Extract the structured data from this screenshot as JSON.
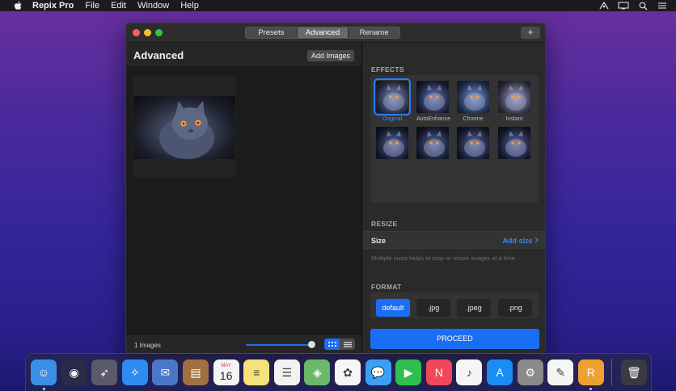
{
  "menubar": {
    "app_name": "Repix Pro",
    "items": [
      "File",
      "Edit",
      "Window",
      "Help"
    ],
    "status_icons": [
      "sync-icon",
      "display-icon",
      "search-icon",
      "list-icon"
    ]
  },
  "window": {
    "tabs": [
      {
        "label": "Presets",
        "active": false
      },
      {
        "label": "Advanced",
        "active": true
      },
      {
        "label": "Rename",
        "active": false
      }
    ],
    "plus_label": "+"
  },
  "left": {
    "title": "Advanced",
    "add_images_label": "Add Images",
    "image_count": "1 Images",
    "zoom_slider": 0.9
  },
  "right": {
    "effects_title": "EFFECTS",
    "effects": [
      {
        "label": "Original",
        "selected": true,
        "tone": ""
      },
      {
        "label": "AutoEnhance",
        "selected": false,
        "tone": "tone-enh"
      },
      {
        "label": "Chrome",
        "selected": false,
        "tone": "tone-chr"
      },
      {
        "label": "Instant",
        "selected": false,
        "tone": "tone-ins"
      },
      {
        "label": "",
        "selected": false,
        "tone": "tone-dk"
      },
      {
        "label": "",
        "selected": false,
        "tone": "tone-dk"
      },
      {
        "label": "",
        "selected": false,
        "tone": "tone-dk"
      },
      {
        "label": "",
        "selected": false,
        "tone": "tone-dk"
      }
    ],
    "resize_title": "RESIZE",
    "size_label": "Size",
    "add_size_label": "Add size",
    "size_hint": "Multiple sizes helps to crop or resize images at a time",
    "format_title": "FORMAT",
    "formats": [
      {
        "label": "default",
        "active": true
      },
      {
        "label": ".jpg",
        "active": false
      },
      {
        "label": ".jpeg",
        "active": false
      },
      {
        "label": ".png",
        "active": false
      }
    ],
    "proceed_label": "PROCEED"
  },
  "calendar": {
    "month": "MAY",
    "day": "16"
  },
  "dock": {
    "items": [
      {
        "name": "finder-icon",
        "bg": "#3a8fe6",
        "running": true
      },
      {
        "name": "siri-icon",
        "bg": "#2a2a4a",
        "running": false
      },
      {
        "name": "launchpad-icon",
        "bg": "#5a5a6a",
        "running": false
      },
      {
        "name": "safari-icon",
        "bg": "#2d8cf0",
        "running": false
      },
      {
        "name": "mail-icon",
        "bg": "#4a78c8",
        "running": false
      },
      {
        "name": "contacts-icon",
        "bg": "#a07040",
        "running": false
      },
      {
        "name": "calendar-icon",
        "bg": "#f4f4f4",
        "running": false
      },
      {
        "name": "notes-icon",
        "bg": "#f5e27a",
        "running": false
      },
      {
        "name": "reminders-icon",
        "bg": "#f2f2f2",
        "running": false
      },
      {
        "name": "maps-icon",
        "bg": "#6ab86a",
        "running": false
      },
      {
        "name": "photos-icon",
        "bg": "#f5f5f5",
        "running": false
      },
      {
        "name": "messages-icon",
        "bg": "#3aa0f5",
        "running": false
      },
      {
        "name": "facetime-icon",
        "bg": "#2fbf4f",
        "running": false
      },
      {
        "name": "news-icon",
        "bg": "#f0485a",
        "running": false
      },
      {
        "name": "music-icon",
        "bg": "#f5f5f5",
        "running": false
      },
      {
        "name": "app-store-icon",
        "bg": "#1a8cf5",
        "running": false
      },
      {
        "name": "system-preferences-icon",
        "bg": "#8a8a8a",
        "running": false
      },
      {
        "name": "textedit-icon",
        "bg": "#f5f5f5",
        "running": false
      },
      {
        "name": "repix-pro-icon",
        "bg": "#f0a030",
        "running": true
      },
      {
        "name": "trash-icon",
        "bg": "#3a3a44",
        "running": false
      }
    ]
  }
}
